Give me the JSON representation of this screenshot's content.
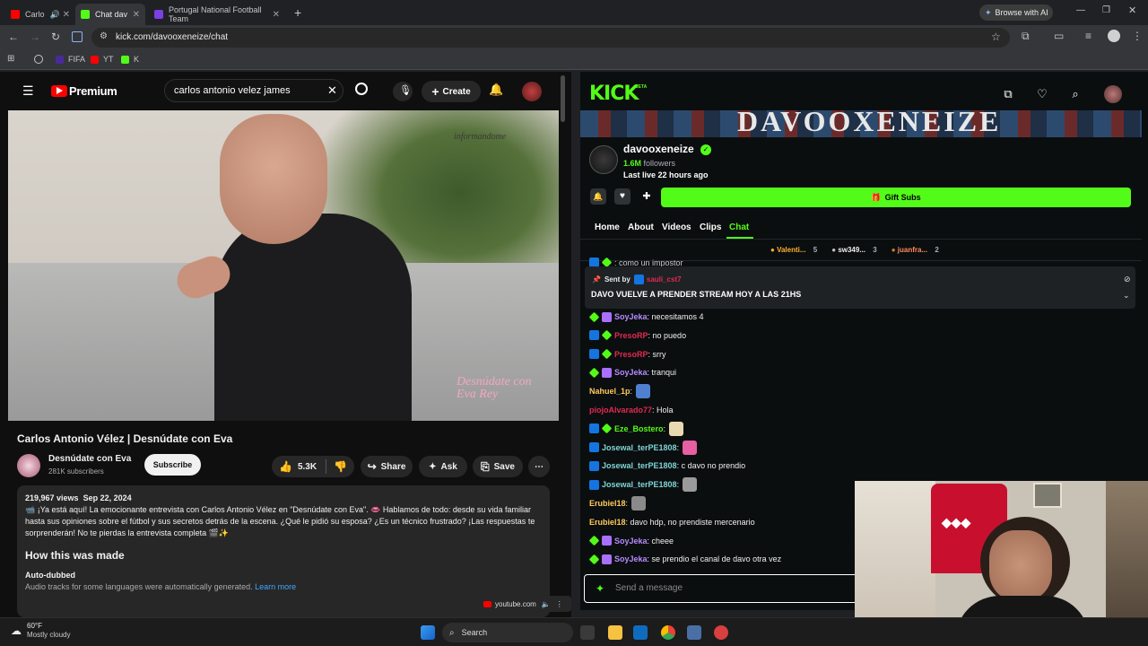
{
  "browser": {
    "tabs": [
      {
        "label": "Carlo",
        "color": "#ff0000"
      },
      {
        "label": "Chat dav",
        "color": "#53fc18"
      },
      {
        "label": "Portugal National Football Team",
        "color": "#7b3fe4"
      }
    ],
    "browse_ai_label": "Browse with AI",
    "url": "kick.com/davooxeneize/chat",
    "bookmarks": [
      {
        "label": "FIFA",
        "color": "#4a2a9a"
      },
      {
        "label": "YT",
        "color": "#ff0000"
      },
      {
        "label": "K",
        "color": "#53fc18"
      }
    ]
  },
  "youtube": {
    "logo_label": "Premium",
    "search_value": "carlos antonio velez james",
    "create_label": "Create",
    "video_watermark": "informandome",
    "video_logo": "Desnúdate con Eva Rey",
    "title": "Carlos Antonio Vélez | Desnúdate con Eva",
    "channel": "Desnúdate con Eva",
    "subscribers": "281K subscribers",
    "subscribe_label": "Subscribe",
    "likes": "5.3K",
    "share_label": "Share",
    "ask_label": "Ask",
    "save_label": "Save",
    "views": "219,967 views",
    "date": "Sep 22, 2024",
    "description": "📹 ¡Ya está aquí! La emocionante entrevista con Carlos Antonio Vélez en \"Desnúdate con Eva\". 👄 Hablamos de todo: desde su vida familiar hasta sus opiniones sobre el fútbol y sus secretos detrás de la escena. ¿Qué le pidió su esposa? ¿Es un técnico frustrado? ¡Las respuestas te sorprenderán! No te pierdas la entrevista completa 🎬✨",
    "how_made_title": "How this was made",
    "auto_dubbed_title": "Auto-dubbed",
    "auto_dubbed_text": "Audio tracks for some languages were automatically generated.",
    "learn_more": "Learn more",
    "pip_domain": "youtube.com"
  },
  "kick": {
    "logo": "KICK",
    "beta": "BETA",
    "banner_text": "DAVOOXENEIZE",
    "channel_name": "davooxeneize",
    "followers_count": "1.6M",
    "followers_label": "followers",
    "last_live": "Last live 22 hours ago",
    "gift_subs_label": "Gift Subs",
    "nav": [
      "Home",
      "About",
      "Videos",
      "Clips",
      "Chat"
    ],
    "active_nav": "Chat",
    "gifters": [
      {
        "name": "Valenti...",
        "count": "5"
      },
      {
        "name": "sw349...",
        "count": "3"
      },
      {
        "name": "juanfra...",
        "count": "2"
      }
    ],
    "partial_line": ": como un impostor",
    "pinned_sent_by": "Sent by",
    "pinned_user": "sauli_cst7",
    "pinned_message": "DAVO VUELVE A PRENDER STREAM HOY A LAS 21HS",
    "chat": [
      {
        "badges": [
          "star",
          "gift"
        ],
        "user": "SoyJeka",
        "color": "#b68bff",
        "text": ": necesitamos 4",
        "emote": ""
      },
      {
        "badges": [
          "mod",
          "star"
        ],
        "user": "PresoRP",
        "color": "#e02a52",
        "text": ": no puedo",
        "emote": ""
      },
      {
        "badges": [
          "mod",
          "star"
        ],
        "user": "PresoRP",
        "color": "#e02a52",
        "text": ": srry",
        "emote": ""
      },
      {
        "badges": [
          "star",
          "gift"
        ],
        "user": "SoyJeka",
        "color": "#b68bff",
        "text": ": tranqui",
        "emote": ""
      },
      {
        "badges": [],
        "user": "Nahuel_1p",
        "color": "#ffc95c",
        "text": ":",
        "emote": "#4f7fcf"
      },
      {
        "badges": [],
        "user": "piojoAlvarado77",
        "color": "#e02a52",
        "text": ": Hola",
        "emote": ""
      },
      {
        "badges": [
          "mod",
          "star"
        ],
        "user": "Eze_Bostero",
        "color": "#53fc18",
        "text": ":",
        "emote": "#e8d9b0"
      },
      {
        "badges": [
          "mod"
        ],
        "user": "Josewal_terPE1808",
        "color": "#7fd4d4",
        "text": ":",
        "emote": "#e85fa3"
      },
      {
        "badges": [
          "mod"
        ],
        "user": "Josewal_terPE1808",
        "color": "#7fd4d4",
        "text": ": c davo no prendio",
        "emote": ""
      },
      {
        "badges": [
          "mod"
        ],
        "user": "Josewal_terPE1808",
        "color": "#7fd4d4",
        "text": ":",
        "emote": "#9a9a9a"
      },
      {
        "badges": [],
        "user": "Erubiel18",
        "color": "#ffc95c",
        "text": ":",
        "emote": "#8a8a8a"
      },
      {
        "badges": [],
        "user": "Erubiel18",
        "color": "#ffc95c",
        "text": ": davo hdp, no prendiste mercenario",
        "emote": ""
      },
      {
        "badges": [
          "star",
          "gift"
        ],
        "user": "SoyJeka",
        "color": "#b68bff",
        "text": ": cheee",
        "emote": ""
      },
      {
        "badges": [
          "star",
          "gift"
        ],
        "user": "SoyJeka",
        "color": "#b68bff",
        "text": ": se prendio el canal de davo otra vez",
        "emote": ""
      }
    ],
    "message_placeholder": "Send a message"
  },
  "taskbar": {
    "temperature": "60°F",
    "weather": "Mostly cloudy",
    "search_label": "Search"
  }
}
